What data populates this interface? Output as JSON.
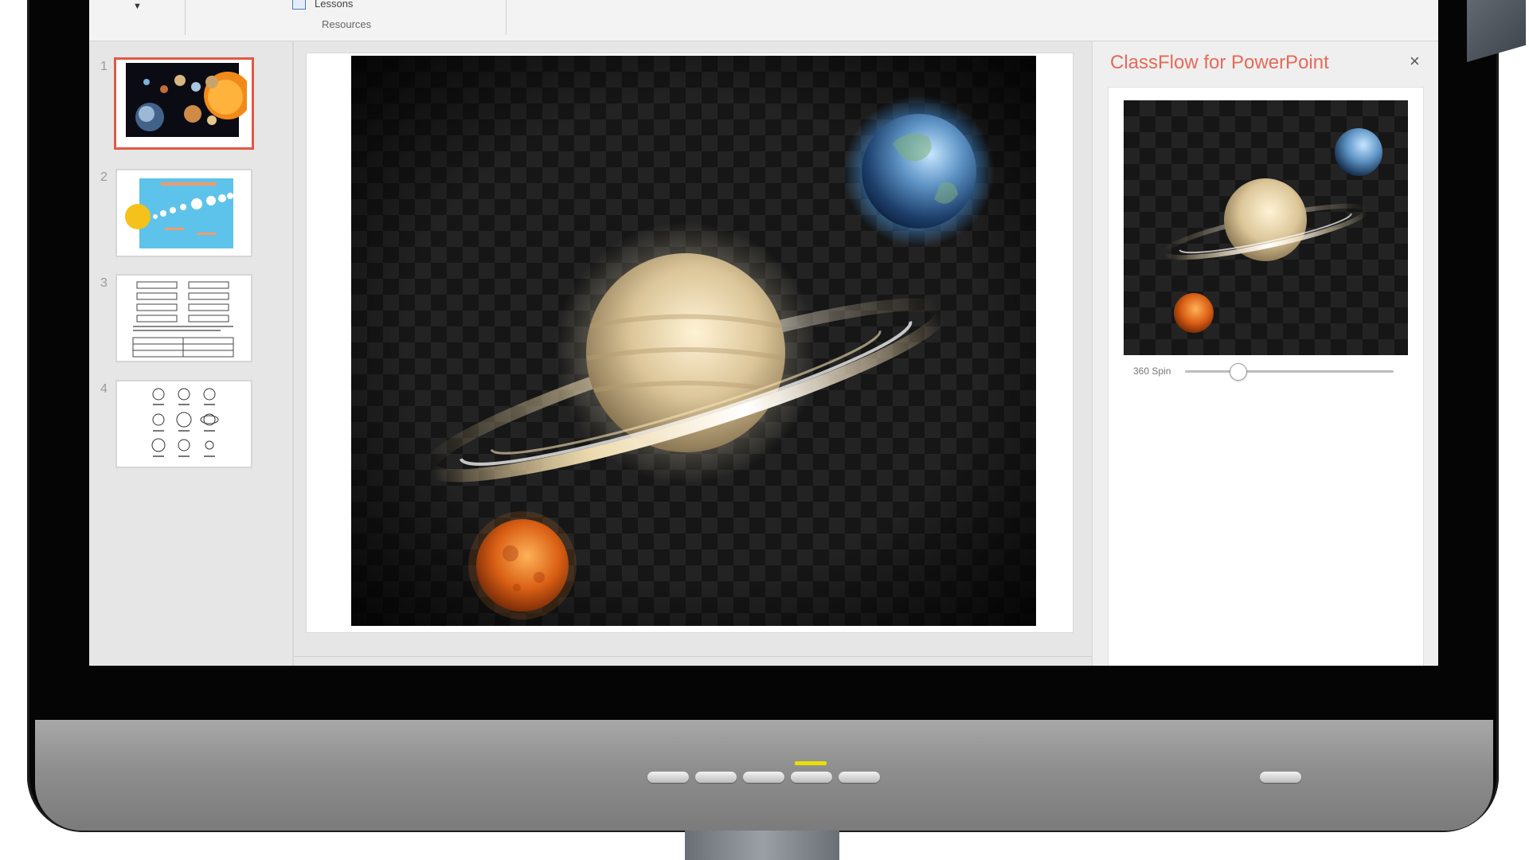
{
  "ribbon": {
    "lessons_label": "Lessons",
    "resources_group": "Resources"
  },
  "thumbnails": [
    {
      "number": "1",
      "selected": true,
      "content": "solar system"
    },
    {
      "number": "2",
      "selected": false,
      "content": "planet diagram"
    },
    {
      "number": "3",
      "selected": false,
      "content": "worksheet table"
    },
    {
      "number": "4",
      "selected": false,
      "content": "planet icons"
    }
  ],
  "task_pane": {
    "title": "ClassFlow for PowerPoint",
    "close_icon": "×",
    "spin_label": "360 Spin",
    "spin_value": 0.25
  },
  "colors": {
    "accent": "#e25843",
    "title_text": "#e56a57",
    "indicator": "#e8e000",
    "bezel": "#050505"
  },
  "icons": {
    "dropdown": "chevron-down-icon",
    "lessons": "lessons-icon",
    "close": "close-icon"
  }
}
